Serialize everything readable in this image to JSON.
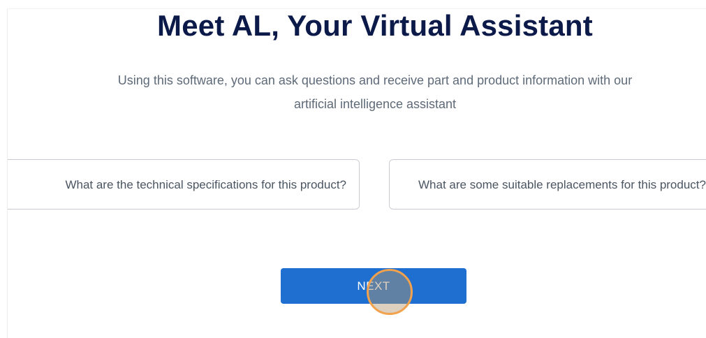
{
  "header": {
    "title": "Meet AL, Your Virtual Assistant",
    "subtitle": "Using this software, you can ask questions and receive part and product information with our artificial intelligence assistant"
  },
  "suggestions": [
    {
      "label": "What are the technical specifications for this product?"
    },
    {
      "label": "What are some suitable replacements for this product?"
    }
  ],
  "actions": {
    "next_label": "NEXT"
  },
  "colors": {
    "title": "#0c1a4a",
    "subtitle": "#5e6a78",
    "button_bg": "#1e6fd0",
    "cursor_ring": "#f2a14c"
  }
}
